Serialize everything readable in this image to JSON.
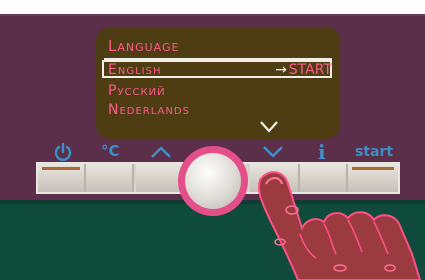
{
  "menu": {
    "title": "Language",
    "selected": "English",
    "options": [
      "Pусский",
      "Nederlands"
    ],
    "hint_arrow": "→",
    "hint_action": "START"
  },
  "controls": {
    "start_label": "start",
    "info_label": "i",
    "temp_label": "°C"
  },
  "colors": {
    "panel": "#5b2f4a",
    "display": "#4e3d12",
    "display_text": "#ff5a8c",
    "icon_blue": "#3d8fc8",
    "knob_ring": "#e44f8a",
    "base": "#0f4b3a"
  },
  "icons": {
    "power": "power-icon",
    "temperature": "temperature-icon",
    "up": "chevron-up-icon",
    "down": "chevron-down-icon",
    "info": "info-icon",
    "start": "start-label",
    "scroll": "chevron-down-icon"
  }
}
